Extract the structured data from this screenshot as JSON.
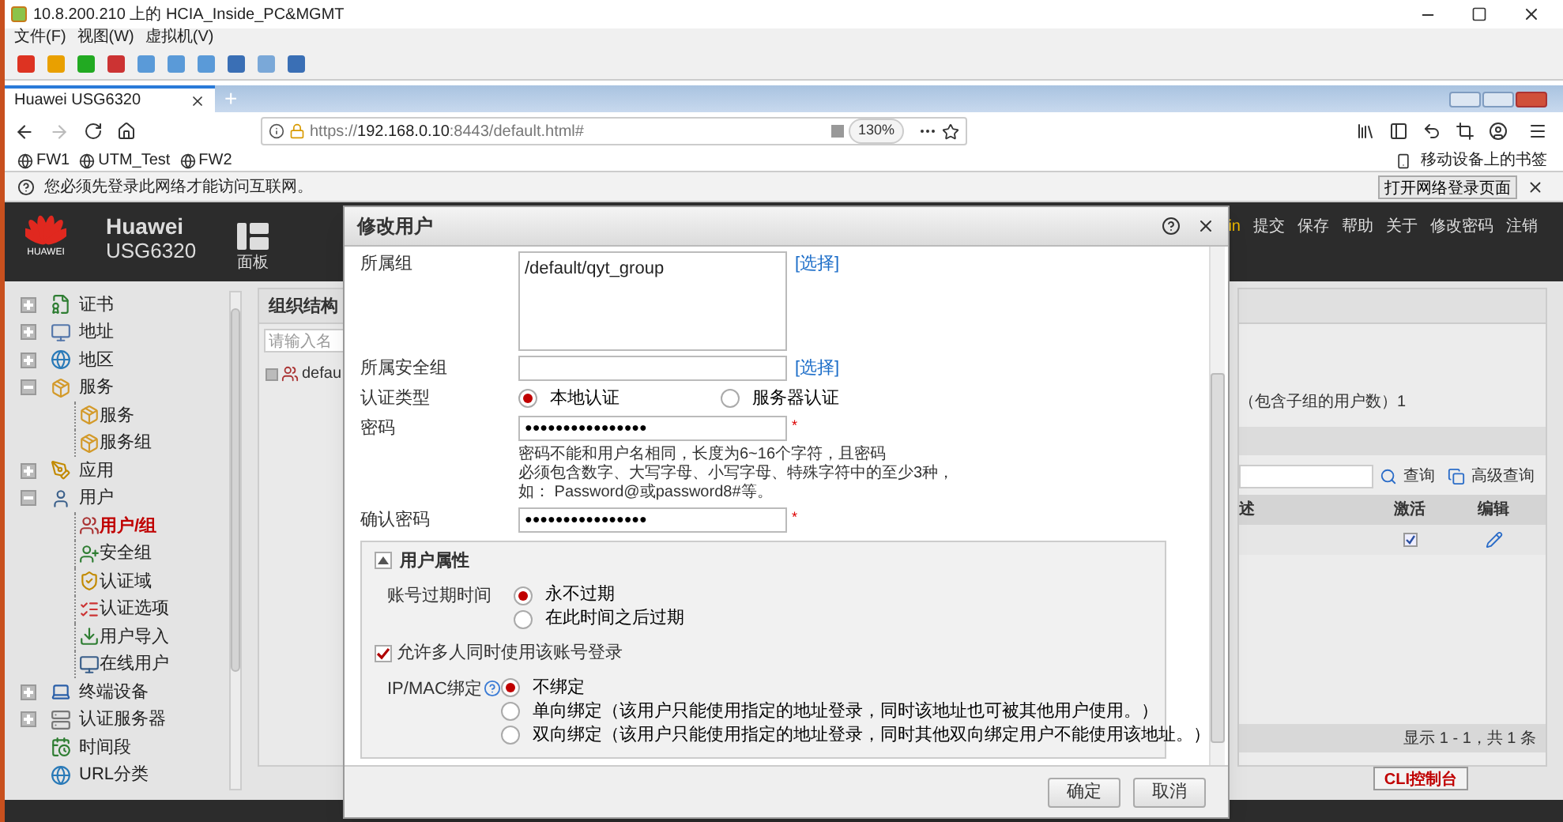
{
  "vm_window": {
    "title": "10.8.200.210 上的 HCIA_Inside_PC&MGMT",
    "menu": [
      "文件(F)",
      "视图(W)",
      "虚拟机(V)"
    ]
  },
  "browser": {
    "tabs": [
      {
        "title": "Huawei USG6320",
        "selected": true
      }
    ],
    "new_tab": "+",
    "url_scheme": "https://",
    "url_host": "192.168.0.10",
    "url_rest": ":8443/default.html#",
    "zoom": "130%",
    "bookmarks": [
      "FW1",
      "UTM_Test",
      "FW2"
    ],
    "mobile_bookmarks": "移动设备上的书签",
    "notice": "您必须先登录此网络才能访问互联网。",
    "notice_button": "打开网络登录页面"
  },
  "app": {
    "brand": "Huawei",
    "model": "USG6320",
    "logo_text": "HUAWEI",
    "panel_label": "面板",
    "user_fragment": "in",
    "header_links": [
      "提交",
      "保存",
      "帮助",
      "关于",
      "修改密码",
      "注销"
    ],
    "nav": [
      {
        "label": "证书",
        "kind": "group",
        "expanded": false
      },
      {
        "label": "地址",
        "kind": "group",
        "expanded": false
      },
      {
        "label": "地区",
        "kind": "group",
        "expanded": false
      },
      {
        "label": "服务",
        "kind": "group",
        "expanded": true,
        "children": [
          {
            "label": "服务",
            "selected": false
          },
          {
            "label": "服务组",
            "selected": false
          }
        ]
      },
      {
        "label": "应用",
        "kind": "group",
        "expanded": false
      },
      {
        "label": "用户",
        "kind": "group",
        "expanded": true,
        "children": [
          {
            "label": "用户/组",
            "selected": true
          },
          {
            "label": "安全组",
            "selected": false
          },
          {
            "label": "认证域",
            "selected": false
          },
          {
            "label": "认证选项",
            "selected": false
          },
          {
            "label": "用户导入",
            "selected": false
          },
          {
            "label": "在线用户",
            "selected": false
          }
        ]
      },
      {
        "label": "终端设备",
        "kind": "group",
        "expanded": false
      },
      {
        "label": "认证服务器",
        "kind": "group",
        "expanded": false
      },
      {
        "label": "时间段",
        "kind": "leaf"
      },
      {
        "label": "URL分类",
        "kind": "leaf"
      }
    ],
    "org_panel": {
      "title": "组织结构",
      "placeholder": "请输入名",
      "tree_item": "defau"
    },
    "summary": "（包含子组的用户数）1",
    "search_button": "查询",
    "advanced_search": "高级查询",
    "table": {
      "columns": [
        "述",
        "激活",
        "编辑"
      ],
      "rows": [
        {
          "active": true
        }
      ]
    },
    "pager": "显示 1 - 1，共 1 条",
    "cli_button": "CLI控制台"
  },
  "dialog": {
    "title": "修改用户",
    "group": {
      "label": "所属组",
      "value": "/default/qyt_group",
      "link": "[选择]"
    },
    "security_group": {
      "label": "所属安全组",
      "link": "[选择]"
    },
    "auth_type": {
      "label": "认证类型",
      "options": [
        {
          "label": "本地认证",
          "selected": true
        },
        {
          "label": "服务器认证",
          "selected": false
        }
      ]
    },
    "password": {
      "label": "密码",
      "value": "●●●●●●●●●●●●●●●●",
      "required_mark": "*"
    },
    "hint": [
      "密码不能和用户名相同，长度为6~16个字符，且密码",
      "必须包含数字、大写字母、小写字母、特殊字符中的至少3种，",
      "如： Password@或password8#等。"
    ],
    "confirm_password": {
      "label": "确认密码",
      "value": "●●●●●●●●●●●●●●●●",
      "required_mark": "*"
    },
    "attributes": {
      "title": "用户属性",
      "expanded": true,
      "expiry": {
        "label": "账号过期时间",
        "options": [
          {
            "label": "永不过期",
            "selected": true
          },
          {
            "label": "在此时间之后过期",
            "selected": false
          }
        ]
      },
      "multi_login": {
        "label": "允许多人同时使用该账号登录",
        "checked": true
      },
      "binding": {
        "label": "IP/MAC绑定",
        "options": [
          {
            "label": "不绑定",
            "selected": true
          },
          {
            "label": "单向绑定（该用户只能使用指定的地址登录，同时该地址也可被其他用户使用。）",
            "selected": false
          },
          {
            "label": "双向绑定（该用户只能使用指定的地址登录，同时其他双向绑定用户不能使用该地址。）",
            "selected": false
          }
        ]
      }
    },
    "buttons": [
      "确定",
      "取消"
    ]
  }
}
